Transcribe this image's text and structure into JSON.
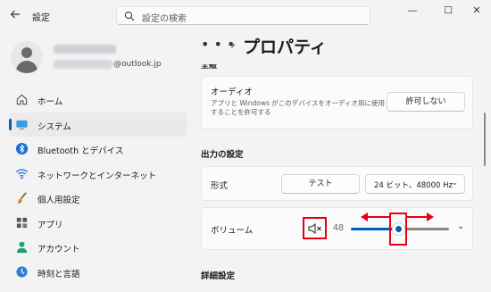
{
  "window": {
    "title": "設定",
    "controls": {
      "minimize": "—",
      "maximize": "☐",
      "close": "✕"
    }
  },
  "search": {
    "placeholder": "設定の検索"
  },
  "profile": {
    "email_suffix": "@outlook.jp"
  },
  "sidebar": {
    "items": [
      {
        "label": "ホーム",
        "icon": "home-icon",
        "active": false
      },
      {
        "label": "システム",
        "icon": "system-icon",
        "active": true
      },
      {
        "label": "Bluetooth とデバイス",
        "icon": "bluetooth-icon",
        "active": false
      },
      {
        "label": "ネットワークとインターネット",
        "icon": "network-icon",
        "active": false
      },
      {
        "label": "個人用設定",
        "icon": "personalization-icon",
        "active": false
      },
      {
        "label": "アプリ",
        "icon": "apps-icon",
        "active": false
      },
      {
        "label": "アカウント",
        "icon": "accounts-icon",
        "active": false
      },
      {
        "label": "時刻と言語",
        "icon": "time-language-icon",
        "active": false
      }
    ]
  },
  "breadcrumb": {
    "dots": "• • •",
    "separator": "›",
    "title": "プロパティ"
  },
  "general": {
    "section_label": "全般",
    "audio": {
      "title": "オーディオ",
      "description": "アプリと Windows がこのデバイスをオーディオ用に使用することを許可する",
      "button": "許可しない"
    }
  },
  "output": {
    "section_label": "出力の設定",
    "format": {
      "label": "形式",
      "test_button": "テスト",
      "selected": "24 ビット、48000 Hz"
    },
    "volume": {
      "label": "ボリューム",
      "value": "48",
      "level": 0.48,
      "muted": false
    }
  },
  "advanced": {
    "section_label": "詳細設定"
  },
  "colors": {
    "accent": "#005fb8",
    "annotation_red": "#e60012",
    "background": "#f3f3f3",
    "card": "#fbfbfb"
  }
}
